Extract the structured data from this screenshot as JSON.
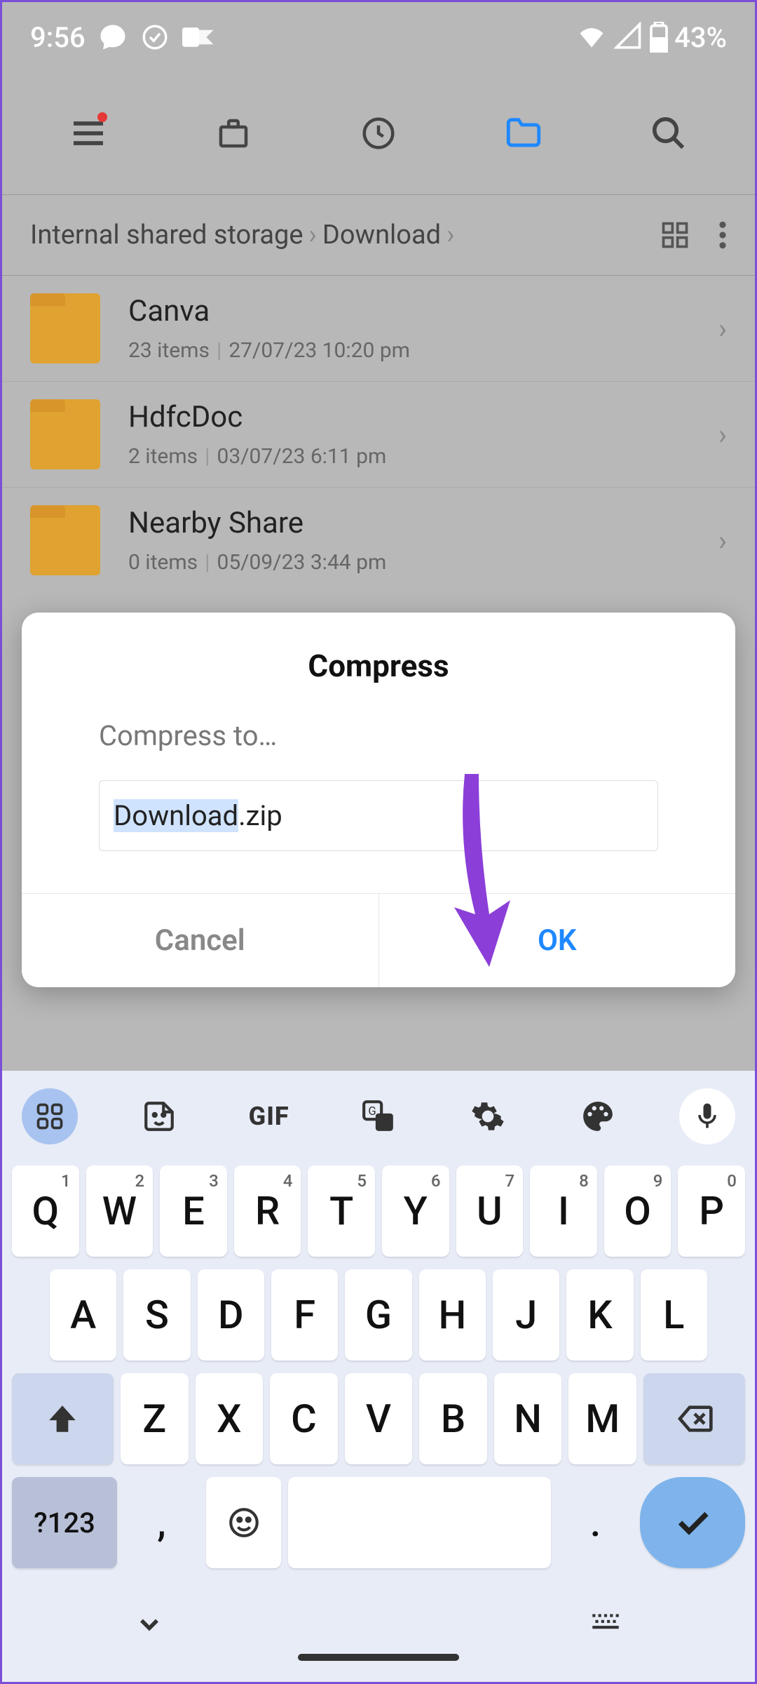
{
  "status": {
    "time": "9:56",
    "battery": "43%"
  },
  "breadcrumb": {
    "root": "Internal shared storage",
    "current": "Download"
  },
  "files": [
    {
      "name": "Canva",
      "count": "23 items",
      "date": "27/07/23 10:20 pm"
    },
    {
      "name": "HdfcDoc",
      "count": "2 items",
      "date": "03/07/23 6:11 pm"
    },
    {
      "name": "Nearby Share",
      "count": "0 items",
      "date": "05/09/23 3:44 pm"
    }
  ],
  "dialog": {
    "title": "Compress",
    "subtitle": "Compress to…",
    "filename_base": "Download",
    "filename_ext": ".zip",
    "cancel": "Cancel",
    "ok": "OK"
  },
  "keyboard": {
    "gif": "GIF",
    "row1": [
      "Q",
      "W",
      "E",
      "R",
      "T",
      "Y",
      "U",
      "I",
      "O",
      "P"
    ],
    "row1sup": [
      "1",
      "2",
      "3",
      "4",
      "5",
      "6",
      "7",
      "8",
      "9",
      "0"
    ],
    "row2": [
      "A",
      "S",
      "D",
      "F",
      "G",
      "H",
      "J",
      "K",
      "L"
    ],
    "row3": [
      "Z",
      "X",
      "C",
      "V",
      "B",
      "N",
      "M"
    ],
    "symbols": "?123",
    "comma": ",",
    "period": "."
  }
}
